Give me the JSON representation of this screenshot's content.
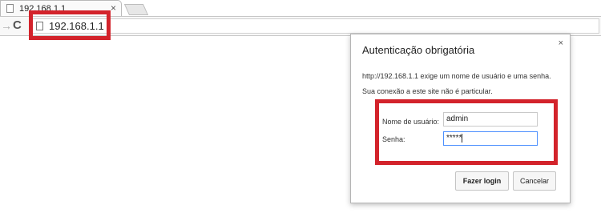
{
  "browser": {
    "tab_title": "192.168.1.1",
    "tab_close": "×",
    "address": "192.168.1.1",
    "reload_glyph": "C",
    "forward_glyph": "→"
  },
  "dialog": {
    "title": "Autenticação obrigatória",
    "close": "×",
    "message_line1": "http://192.168.1.1 exige um nome de usuário e uma senha.",
    "message_line2": "Sua conexão a este site não é particular.",
    "username_label": "Nome de usuário:",
    "username_value": "admin",
    "password_label": "Senha:",
    "password_value": "*****",
    "login_button": "Fazer login",
    "cancel_button": "Cancelar"
  },
  "icons": {
    "tab_favicon": "file-icon",
    "omnibox_icon": "file-icon",
    "reload": "reload-icon",
    "forward": "forward-icon"
  },
  "colors": {
    "highlight": "#d3232b",
    "focus_border": "#4d90fe"
  }
}
